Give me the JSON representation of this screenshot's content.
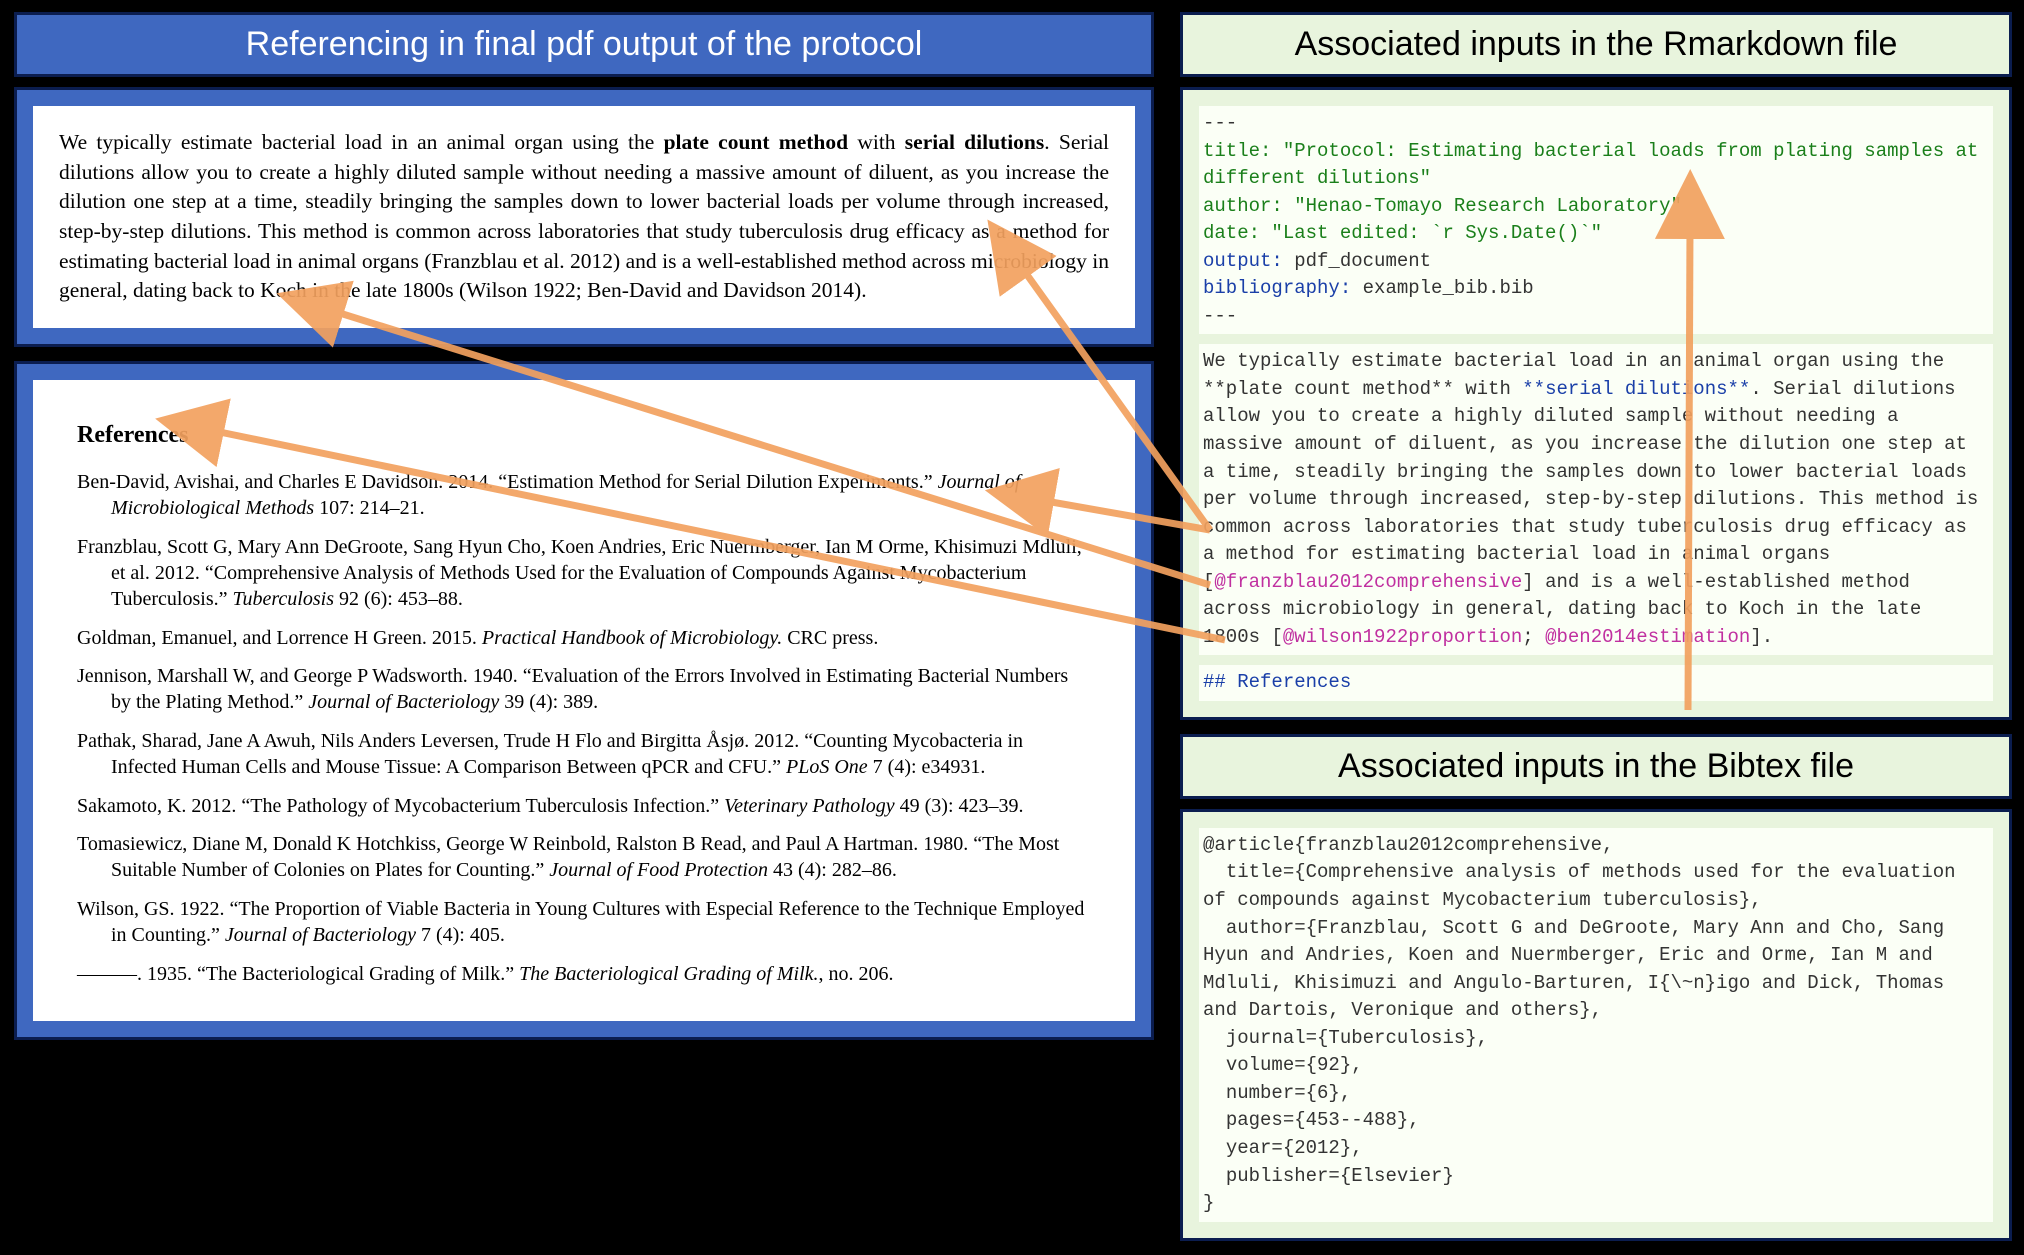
{
  "left_title": "Referencing in final pdf output of the protocol",
  "main_text": {
    "p1": "We typically estimate bacterial load in an animal organ using the ",
    "b1": "plate count method",
    "p2": " with ",
    "b2": "serial dilutions",
    "p3": ". Serial dilutions allow you to create a highly diluted sample without needing a massive amount of diluent, as you increase the dilution one step at a time, steadily bringing the samples down to lower bacterial loads per volume through increased, step-by-step dilutions. This method is common across laboratories that study tuberculosis drug efficacy as a method for estimating bacterial load in animal organs (Franzblau et al. 2012) and is a well-established method across microbiology in general, dating back to Koch in the late 1800s (Wilson 1922; Ben-David and Davidson 2014)."
  },
  "refs_heading": "References",
  "refs": [
    {
      "a": "Ben-David, Avishai, and Charles E Davidson. 2014. “Estimation Method for Serial Dilution Experiments.” ",
      "i": "Journal of Microbiological Methods",
      "t": " 107: 214–21."
    },
    {
      "a": "Franzblau, Scott G, Mary Ann DeGroote, Sang Hyun Cho, Koen Andries, Eric Nuermberger, Ian M Orme, Khisimuzi Mdluli, et al. 2012. “Comprehensive Analysis of Methods Used for the Evaluation of Compounds Against Mycobacterium Tuberculosis.” ",
      "i": "Tuberculosis",
      "t": " 92 (6): 453–88."
    },
    {
      "a": "Goldman, Emanuel, and Lorrence H Green. 2015. ",
      "i": "Practical Handbook of Microbiology.",
      "t": " CRC press."
    },
    {
      "a": "Jennison, Marshall W, and George P Wadsworth. 1940. “Evaluation of the Errors Involved in Estimating Bacterial Numbers by the Plating Method.” ",
      "i": "Journal of Bacteriology",
      "t": " 39 (4): 389."
    },
    {
      "a": "Pathak, Sharad, Jane A Awuh, Nils Anders Leversen, Trude H Flo and Birgitta Åsjø. 2012. “Counting Mycobacteria in Infected Human Cells and Mouse Tissue: A Comparison Between qPCR and CFU.” ",
      "i": "PLoS One",
      "t": " 7 (4): e34931."
    },
    {
      "a": "Sakamoto, K. 2012. “The Pathology of Mycobacterium Tuberculosis Infection.” ",
      "i": "Veterinary Pathology",
      "t": " 49 (3): 423–39."
    },
    {
      "a": "Tomasiewicz, Diane M, Donald K Hotchkiss, George W Reinbold, Ralston B Read, and Paul A Hartman. 1980. “The Most Suitable Number of Colonies on Plates for Counting.” ",
      "i": "Journal of Food Protection",
      "t": " 43 (4): 282–86."
    },
    {
      "a": "Wilson, GS. 1922. “The Proportion of Viable Bacteria in Young Cultures with Especial Reference to the Technique Employed in Counting.” ",
      "i": "Journal of Bacteriology",
      "t": " 7 (4): 405."
    },
    {
      "a": "———. 1935. “The Bacteriological Grading of Milk.” ",
      "i": "The Bacteriological Grading of Milk.",
      "t": ", no. 206."
    }
  ],
  "rmd_title": "Associated inputs in the Rmarkdown file",
  "rmd": {
    "dash": "---",
    "title": "title: \"Protocol: Estimating bacterial loads from plating samples at different dilutions\"",
    "author": "author: \"Henao-Tomayo Research Laboratory\"",
    "date": "date: \"Last edited: `r Sys.Date()`\"",
    "out_k": "output:",
    "out_v": " pdf_document",
    "bib_k": "bibliography:",
    "bib_v": " example_bib.bib",
    "body1": "We typically estimate bacterial load in an animal organ using the **plate count method** with ",
    "sd": "**serial dilutions**",
    "body2": ". Serial dilutions allow you to create a highly diluted sample without needing a massive amount of diluent, as you increase the dilution one step at a time, steadily bringing the samples down to lower bacterial loads per volume through increased, step-by-step dilutions. This method is common across laboratories that study tuberculosis drug efficacy as a method for estimating bacterial load in animal organs [",
    "cite1": "@franzblau2012comprehensive",
    "body3": "] and is a well-established method across microbiology in general, dating back to Koch in the late 1800s [",
    "cite2": "@wilson1922proportion",
    "sep": "; ",
    "cite3": "@ben2014estimation",
    "body4": "].",
    "refhead": "## References"
  },
  "bibtex_title": "Associated inputs in the Bibtex file",
  "bibtex": "@article{franzblau2012comprehensive,\n  title={Comprehensive analysis of methods used for the evaluation of compounds against Mycobacterium tuberculosis},\n  author={Franzblau, Scott G and DeGroote, Mary Ann and Cho, Sang Hyun and Andries, Koen and Nuermberger, Eric and Orme, Ian M and Mdluli, Khisimuzi and Angulo-Barturen, I{\\~n}igo and Dick, Thomas and Dartois, Veronique and others},\n  journal={Tuberculosis},\n  volume={92},\n  number={6},\n  pages={453--488},\n  year={2012},\n  publisher={Elsevier}\n}"
}
